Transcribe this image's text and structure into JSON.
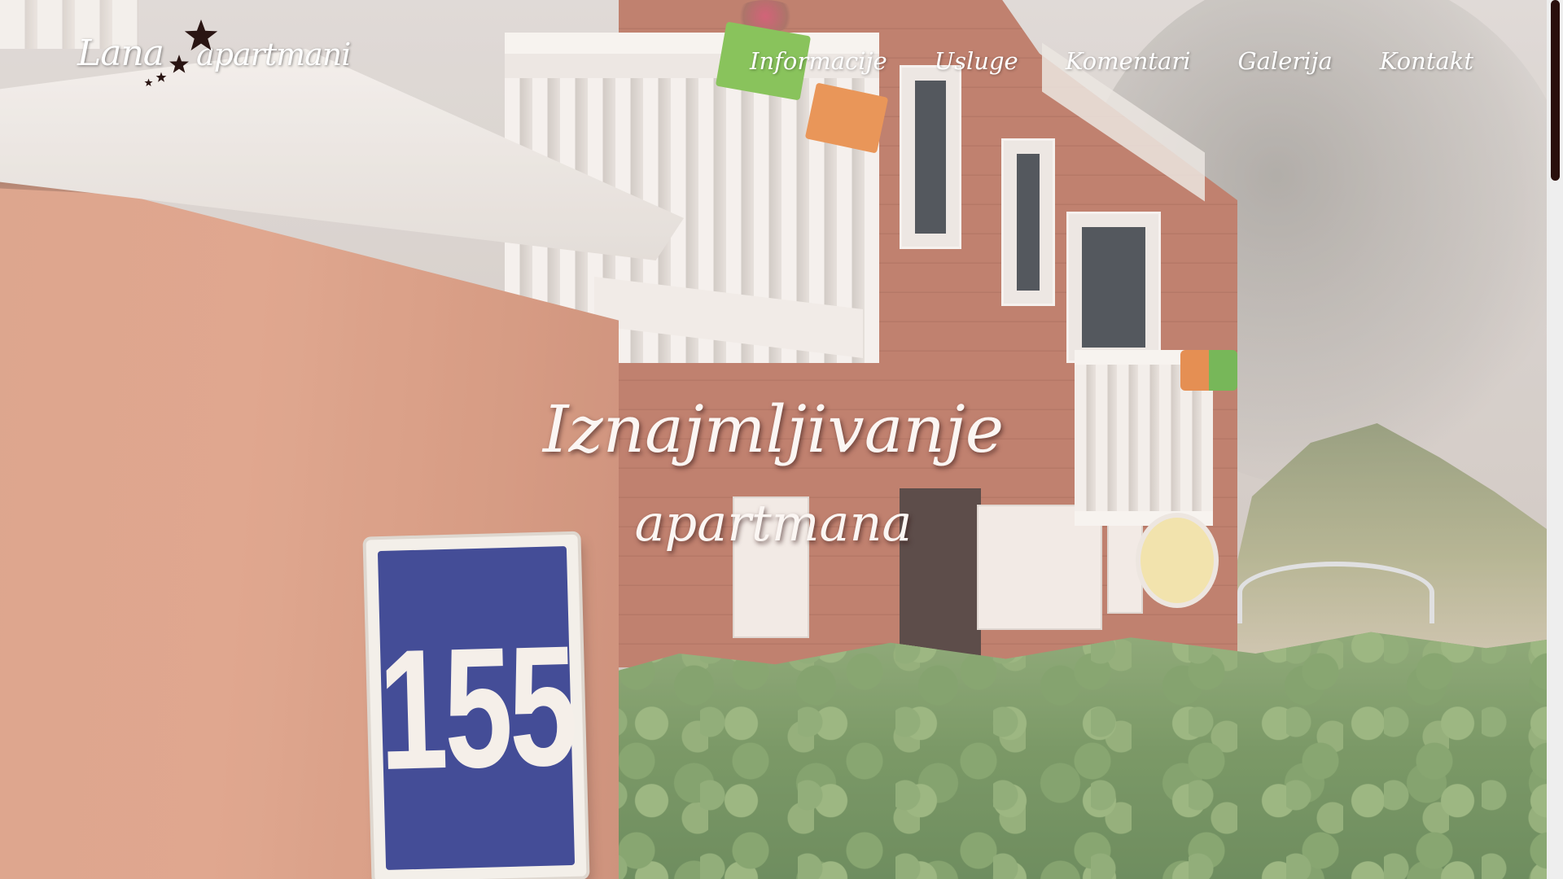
{
  "brand": {
    "logo_first": "Lana",
    "logo_second": "apartmani",
    "star_color": "#2a1513"
  },
  "nav": {
    "items": [
      {
        "label": "Informacije"
      },
      {
        "label": "Usluge"
      },
      {
        "label": "Komentari"
      },
      {
        "label": "Galerija"
      },
      {
        "label": "Kontakt"
      }
    ]
  },
  "hero": {
    "title": "Iznajmljivanje",
    "subtitle": "apartmana",
    "house_number": "155"
  },
  "scrollbar": {
    "thumb_color": "#2a0f0d"
  }
}
